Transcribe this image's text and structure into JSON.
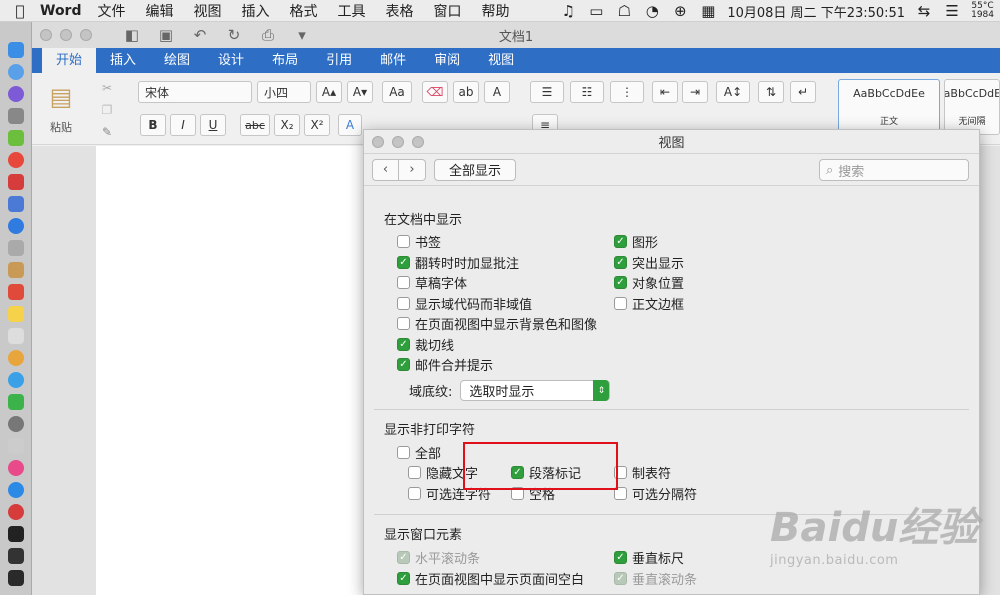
{
  "menubar": {
    "app_name": "Word",
    "items": [
      "文件",
      "编辑",
      "视图",
      "插入",
      "格式",
      "工具",
      "表格",
      "窗口",
      "帮助"
    ],
    "clock": "10月08日 周二 下午23:50:51",
    "temperature": "55°C",
    "fan": "1984"
  },
  "window": {
    "doc_title": "文档1",
    "tabs": [
      "开始",
      "插入",
      "绘图",
      "设计",
      "布局",
      "引用",
      "邮件",
      "审阅",
      "视图"
    ],
    "active_tab": "开始"
  },
  "ribbon": {
    "paste_label": "粘贴",
    "font_name": "宋体",
    "font_size": "小四",
    "style_preview_1": "AaBbCcDdEe",
    "style_name_1": "正文",
    "style_preview_2": "AaBbCcDdEe",
    "style_name_2": "无间隔",
    "bold": "B",
    "italic": "I",
    "underline": "U",
    "strike": "abc",
    "sub": "X₂",
    "sup": "X²"
  },
  "panel": {
    "title": "视图",
    "show_all": "全部显示",
    "search_placeholder": "搜索",
    "section_document": "在文档中显示",
    "doc_left": [
      {
        "label": "书签",
        "checked": false
      },
      {
        "label": "翻转时时加显批注",
        "checked": true
      },
      {
        "label": "草稿字体",
        "checked": false
      },
      {
        "label": "显示域代码而非域值",
        "checked": false
      },
      {
        "label": "在页面视图中显示背景色和图像",
        "checked": false
      },
      {
        "label": "裁切线",
        "checked": true
      },
      {
        "label": "邮件合并提示",
        "checked": true
      }
    ],
    "doc_right": [
      {
        "label": "图形",
        "checked": true
      },
      {
        "label": "突出显示",
        "checked": true
      },
      {
        "label": "对象位置",
        "checked": true
      },
      {
        "label": "正文边框",
        "checked": false
      }
    ],
    "field_shading_label": "域底纹:",
    "field_shading_value": "选取时显示",
    "section_nonprint": "显示非打印字符",
    "all_label": "全部",
    "nonprint": [
      {
        "label": "隐藏文字",
        "checked": false
      },
      {
        "label": "段落标记",
        "checked": true
      },
      {
        "label": "制表符",
        "checked": false
      },
      {
        "label": "可选连字符",
        "checked": false
      },
      {
        "label": "空格",
        "checked": false
      },
      {
        "label": "可选分隔符",
        "checked": false
      }
    ],
    "section_window": "显示窗口元素",
    "window_left": [
      {
        "label": "水平滚动条",
        "checked": true,
        "disabled": true
      },
      {
        "label": "在页面视图中显示页面间空白",
        "checked": true,
        "disabled": false
      }
    ],
    "window_right": [
      {
        "label": "垂直标尺",
        "checked": true,
        "disabled": false
      },
      {
        "label": "垂直滚动条",
        "checked": true,
        "disabled": true
      }
    ]
  },
  "watermark": {
    "brand": "Baidu经验",
    "url": "jingyan.baidu.com"
  }
}
